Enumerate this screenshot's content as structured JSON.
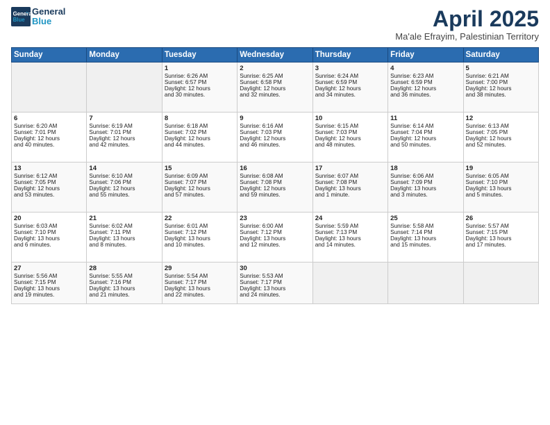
{
  "header": {
    "logo_line1": "General",
    "logo_line2": "Blue",
    "title": "April 2025",
    "subtitle": "Ma'ale Efrayim, Palestinian Territory"
  },
  "days_of_week": [
    "Sunday",
    "Monday",
    "Tuesday",
    "Wednesday",
    "Thursday",
    "Friday",
    "Saturday"
  ],
  "weeks": [
    [
      {
        "day": "",
        "info": ""
      },
      {
        "day": "",
        "info": ""
      },
      {
        "day": "1",
        "info": "Sunrise: 6:26 AM\nSunset: 6:57 PM\nDaylight: 12 hours\nand 30 minutes."
      },
      {
        "day": "2",
        "info": "Sunrise: 6:25 AM\nSunset: 6:58 PM\nDaylight: 12 hours\nand 32 minutes."
      },
      {
        "day": "3",
        "info": "Sunrise: 6:24 AM\nSunset: 6:59 PM\nDaylight: 12 hours\nand 34 minutes."
      },
      {
        "day": "4",
        "info": "Sunrise: 6:23 AM\nSunset: 6:59 PM\nDaylight: 12 hours\nand 36 minutes."
      },
      {
        "day": "5",
        "info": "Sunrise: 6:21 AM\nSunset: 7:00 PM\nDaylight: 12 hours\nand 38 minutes."
      }
    ],
    [
      {
        "day": "6",
        "info": "Sunrise: 6:20 AM\nSunset: 7:01 PM\nDaylight: 12 hours\nand 40 minutes."
      },
      {
        "day": "7",
        "info": "Sunrise: 6:19 AM\nSunset: 7:01 PM\nDaylight: 12 hours\nand 42 minutes."
      },
      {
        "day": "8",
        "info": "Sunrise: 6:18 AM\nSunset: 7:02 PM\nDaylight: 12 hours\nand 44 minutes."
      },
      {
        "day": "9",
        "info": "Sunrise: 6:16 AM\nSunset: 7:03 PM\nDaylight: 12 hours\nand 46 minutes."
      },
      {
        "day": "10",
        "info": "Sunrise: 6:15 AM\nSunset: 7:03 PM\nDaylight: 12 hours\nand 48 minutes."
      },
      {
        "day": "11",
        "info": "Sunrise: 6:14 AM\nSunset: 7:04 PM\nDaylight: 12 hours\nand 50 minutes."
      },
      {
        "day": "12",
        "info": "Sunrise: 6:13 AM\nSunset: 7:05 PM\nDaylight: 12 hours\nand 52 minutes."
      }
    ],
    [
      {
        "day": "13",
        "info": "Sunrise: 6:12 AM\nSunset: 7:05 PM\nDaylight: 12 hours\nand 53 minutes."
      },
      {
        "day": "14",
        "info": "Sunrise: 6:10 AM\nSunset: 7:06 PM\nDaylight: 12 hours\nand 55 minutes."
      },
      {
        "day": "15",
        "info": "Sunrise: 6:09 AM\nSunset: 7:07 PM\nDaylight: 12 hours\nand 57 minutes."
      },
      {
        "day": "16",
        "info": "Sunrise: 6:08 AM\nSunset: 7:08 PM\nDaylight: 12 hours\nand 59 minutes."
      },
      {
        "day": "17",
        "info": "Sunrise: 6:07 AM\nSunset: 7:08 PM\nDaylight: 13 hours\nand 1 minute."
      },
      {
        "day": "18",
        "info": "Sunrise: 6:06 AM\nSunset: 7:09 PM\nDaylight: 13 hours\nand 3 minutes."
      },
      {
        "day": "19",
        "info": "Sunrise: 6:05 AM\nSunset: 7:10 PM\nDaylight: 13 hours\nand 5 minutes."
      }
    ],
    [
      {
        "day": "20",
        "info": "Sunrise: 6:03 AM\nSunset: 7:10 PM\nDaylight: 13 hours\nand 6 minutes."
      },
      {
        "day": "21",
        "info": "Sunrise: 6:02 AM\nSunset: 7:11 PM\nDaylight: 13 hours\nand 8 minutes."
      },
      {
        "day": "22",
        "info": "Sunrise: 6:01 AM\nSunset: 7:12 PM\nDaylight: 13 hours\nand 10 minutes."
      },
      {
        "day": "23",
        "info": "Sunrise: 6:00 AM\nSunset: 7:12 PM\nDaylight: 13 hours\nand 12 minutes."
      },
      {
        "day": "24",
        "info": "Sunrise: 5:59 AM\nSunset: 7:13 PM\nDaylight: 13 hours\nand 14 minutes."
      },
      {
        "day": "25",
        "info": "Sunrise: 5:58 AM\nSunset: 7:14 PM\nDaylight: 13 hours\nand 15 minutes."
      },
      {
        "day": "26",
        "info": "Sunrise: 5:57 AM\nSunset: 7:15 PM\nDaylight: 13 hours\nand 17 minutes."
      }
    ],
    [
      {
        "day": "27",
        "info": "Sunrise: 5:56 AM\nSunset: 7:15 PM\nDaylight: 13 hours\nand 19 minutes."
      },
      {
        "day": "28",
        "info": "Sunrise: 5:55 AM\nSunset: 7:16 PM\nDaylight: 13 hours\nand 21 minutes."
      },
      {
        "day": "29",
        "info": "Sunrise: 5:54 AM\nSunset: 7:17 PM\nDaylight: 13 hours\nand 22 minutes."
      },
      {
        "day": "30",
        "info": "Sunrise: 5:53 AM\nSunset: 7:17 PM\nDaylight: 13 hours\nand 24 minutes."
      },
      {
        "day": "",
        "info": ""
      },
      {
        "day": "",
        "info": ""
      },
      {
        "day": "",
        "info": ""
      }
    ]
  ]
}
